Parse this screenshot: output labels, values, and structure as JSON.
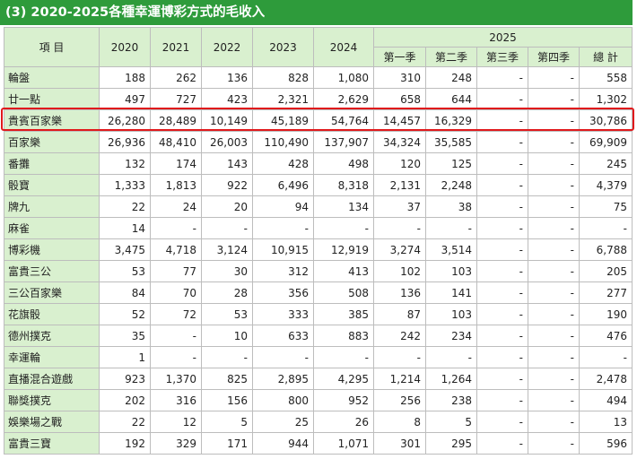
{
  "title": "(3) 2020-2025各種幸運博彩方式的毛收入",
  "header": {
    "item": "項 目",
    "years": [
      "2020",
      "2021",
      "2022",
      "2023",
      "2024"
    ],
    "group_2025": "2025",
    "quarters": [
      "第一季",
      "第二季",
      "第三季",
      "第四季",
      "總 計"
    ]
  },
  "rows": [
    {
      "name": "輪盤",
      "v": [
        "188",
        "262",
        "136",
        "828",
        "1,080",
        "310",
        "248",
        "-",
        "-",
        "558"
      ]
    },
    {
      "name": "廿一點",
      "v": [
        "497",
        "727",
        "423",
        "2,321",
        "2,629",
        "658",
        "644",
        "-",
        "-",
        "1,302"
      ]
    },
    {
      "name": "貴賓百家樂",
      "v": [
        "26,280",
        "28,489",
        "10,149",
        "45,189",
        "54,764",
        "14,457",
        "16,329",
        "-",
        "-",
        "30,786"
      ],
      "highlighted": true
    },
    {
      "name": "百家樂",
      "v": [
        "26,936",
        "48,410",
        "26,003",
        "110,490",
        "137,907",
        "34,324",
        "35,585",
        "-",
        "-",
        "69,909"
      ]
    },
    {
      "name": "番攤",
      "v": [
        "132",
        "174",
        "143",
        "428",
        "498",
        "120",
        "125",
        "-",
        "-",
        "245"
      ]
    },
    {
      "name": "骰寶",
      "v": [
        "1,333",
        "1,813",
        "922",
        "6,496",
        "8,318",
        "2,131",
        "2,248",
        "-",
        "-",
        "4,379"
      ]
    },
    {
      "name": "牌九",
      "v": [
        "22",
        "24",
        "20",
        "94",
        "134",
        "37",
        "38",
        "-",
        "-",
        "75"
      ]
    },
    {
      "name": "麻雀",
      "v": [
        "14",
        "-",
        "-",
        "-",
        "-",
        "-",
        "-",
        "-",
        "-",
        "-"
      ]
    },
    {
      "name": "博彩機",
      "v": [
        "3,475",
        "4,718",
        "3,124",
        "10,915",
        "12,919",
        "3,274",
        "3,514",
        "-",
        "-",
        "6,788"
      ]
    },
    {
      "name": "富貴三公",
      "v": [
        "53",
        "77",
        "30",
        "312",
        "413",
        "102",
        "103",
        "-",
        "-",
        "205"
      ]
    },
    {
      "name": "三公百家樂",
      "v": [
        "84",
        "70",
        "28",
        "356",
        "508",
        "136",
        "141",
        "-",
        "-",
        "277"
      ]
    },
    {
      "name": "花旗骰",
      "v": [
        "52",
        "72",
        "53",
        "333",
        "385",
        "87",
        "103",
        "-",
        "-",
        "190"
      ]
    },
    {
      "name": "德州撲克",
      "v": [
        "35",
        "-",
        "10",
        "633",
        "883",
        "242",
        "234",
        "-",
        "-",
        "476"
      ]
    },
    {
      "name": "幸運輪",
      "v": [
        "1",
        "-",
        "-",
        "-",
        "-",
        "-",
        "-",
        "-",
        "-",
        "-"
      ]
    },
    {
      "name": "直播混合遊戲",
      "v": [
        "923",
        "1,370",
        "825",
        "2,895",
        "4,295",
        "1,214",
        "1,264",
        "-",
        "-",
        "2,478"
      ]
    },
    {
      "name": "聯獎撲克",
      "v": [
        "202",
        "316",
        "156",
        "800",
        "952",
        "256",
        "238",
        "-",
        "-",
        "494"
      ]
    },
    {
      "name": "娛樂場之戰",
      "v": [
        "22",
        "12",
        "5",
        "25",
        "26",
        "8",
        "5",
        "-",
        "-",
        "13"
      ]
    },
    {
      "name": "富貴三寶",
      "v": [
        "192",
        "329",
        "171",
        "944",
        "1,071",
        "301",
        "295",
        "-",
        "-",
        "596"
      ]
    }
  ],
  "colors": {
    "title_bg": "#2e9b3b",
    "header_bg": "#d9f0cf",
    "highlight": "#e0191c",
    "border": "#bdbdbd"
  }
}
